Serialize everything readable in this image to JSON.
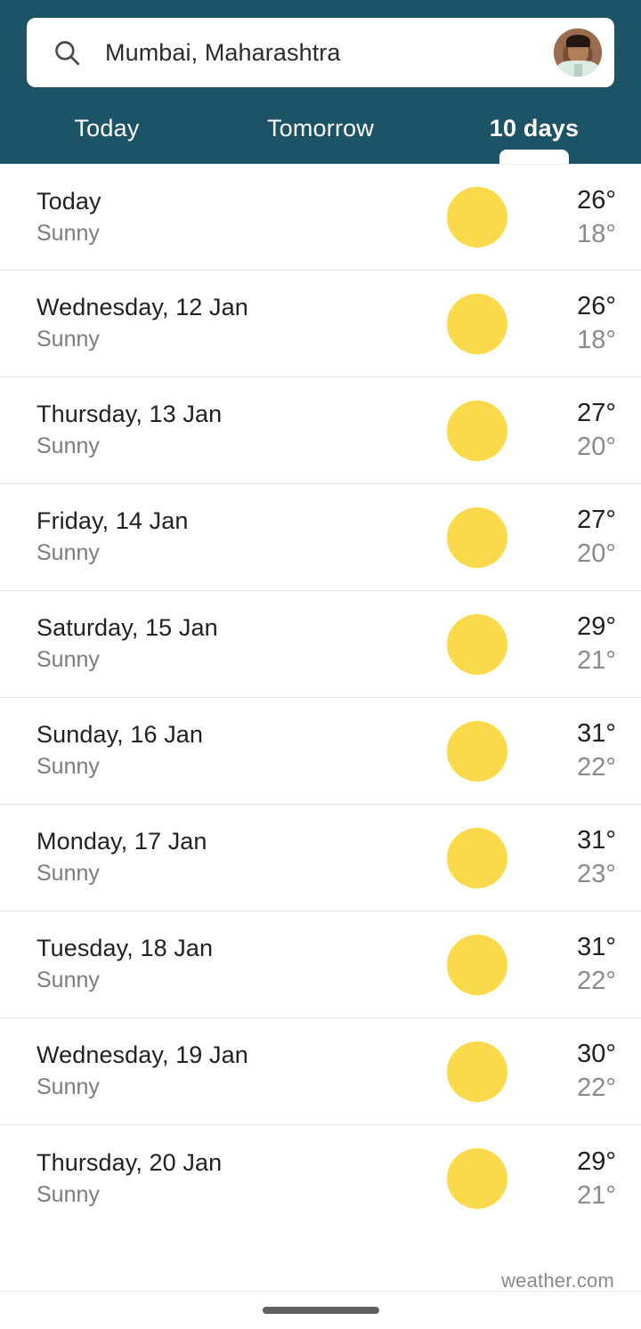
{
  "search": {
    "value": "Mumbai, Maharashtra",
    "placeholder": "Search",
    "icon": "search-icon",
    "avatar_icon": "user-avatar"
  },
  "tabs": [
    {
      "label": "Today",
      "active": false
    },
    {
      "label": "Tomorrow",
      "active": false
    },
    {
      "label": "10 days",
      "active": true
    }
  ],
  "forecast": [
    {
      "day": "Today",
      "condition": "Sunny",
      "icon": "sun-icon",
      "high": "26°",
      "low": "18°"
    },
    {
      "day": "Wednesday, 12 Jan",
      "condition": "Sunny",
      "icon": "sun-icon",
      "high": "26°",
      "low": "18°"
    },
    {
      "day": "Thursday, 13 Jan",
      "condition": "Sunny",
      "icon": "sun-icon",
      "high": "27°",
      "low": "20°"
    },
    {
      "day": "Friday, 14 Jan",
      "condition": "Sunny",
      "icon": "sun-icon",
      "high": "27°",
      "low": "20°"
    },
    {
      "day": "Saturday, 15 Jan",
      "condition": "Sunny",
      "icon": "sun-icon",
      "high": "29°",
      "low": "21°"
    },
    {
      "day": "Sunday, 16 Jan",
      "condition": "Sunny",
      "icon": "sun-icon",
      "high": "31°",
      "low": "22°"
    },
    {
      "day": "Monday, 17 Jan",
      "condition": "Sunny",
      "icon": "sun-icon",
      "high": "31°",
      "low": "23°"
    },
    {
      "day": "Tuesday, 18 Jan",
      "condition": "Sunny",
      "icon": "sun-icon",
      "high": "31°",
      "low": "22°"
    },
    {
      "day": "Wednesday, 19 Jan",
      "condition": "Sunny",
      "icon": "sun-icon",
      "high": "30°",
      "low": "22°"
    },
    {
      "day": "Thursday, 20 Jan",
      "condition": "Sunny",
      "icon": "sun-icon",
      "high": "29°",
      "low": "21°"
    }
  ],
  "footer": {
    "attribution": "weather.com"
  },
  "colors": {
    "header_teal": "#1d5367",
    "sun_yellow": "#fada4a",
    "text_primary": "#212121",
    "text_secondary": "#7c7c7c",
    "divider": "#e4e4e4"
  }
}
